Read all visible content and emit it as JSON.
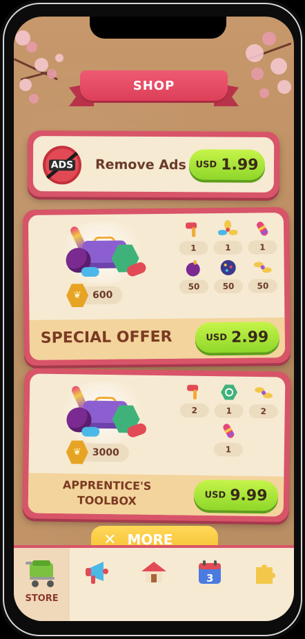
{
  "header": {
    "title": "SHOP"
  },
  "remove_ads": {
    "badge": "ADS",
    "label": "Remove Ads",
    "currency": "USD",
    "price": "1.99"
  },
  "special_offer": {
    "title": "SPECIAL OFFER",
    "coins": "600",
    "currency": "USD",
    "price": "2.99",
    "items": [
      {
        "icon": "hammer-icon",
        "qty": "1"
      },
      {
        "icon": "propeller-icon",
        "qty": "1"
      },
      {
        "icon": "rocket-icon",
        "qty": "1"
      },
      {
        "icon": "bomb-icon",
        "qty": "50"
      },
      {
        "icon": "disco-ball-icon",
        "qty": "50"
      },
      {
        "icon": "fan-icon",
        "qty": "50"
      }
    ]
  },
  "apprentice_toolbox": {
    "title_line1": "APPRENTICE'S",
    "title_line2": "TOOLBOX",
    "coins": "3000",
    "currency": "USD",
    "price": "9.99",
    "items": [
      {
        "icon": "hammer-icon",
        "qty": "2"
      },
      {
        "icon": "shuffle-icon",
        "qty": "1"
      },
      {
        "icon": "fan-icon",
        "qty": "2"
      },
      {
        "icon": "rocket-icon",
        "qty": "1"
      }
    ]
  },
  "more_button": {
    "icon": "chevron-down-icon",
    "label": "MORE"
  },
  "tabbar": {
    "tabs": [
      {
        "icon": "shopping-cart-icon",
        "label": "STORE",
        "active": true
      },
      {
        "icon": "megaphone-icon",
        "label": "",
        "active": false
      },
      {
        "icon": "house-icon",
        "label": "",
        "active": false
      },
      {
        "icon": "calendar-icon",
        "label": "",
        "active": false,
        "calendar_day": "3"
      },
      {
        "icon": "puzzle-icon",
        "label": "",
        "active": false
      }
    ]
  },
  "colors": {
    "accent_red": "#d85468",
    "buy_green": "#8fd72a",
    "card_cream": "#f6ead3",
    "background_wood": "#c49669"
  }
}
